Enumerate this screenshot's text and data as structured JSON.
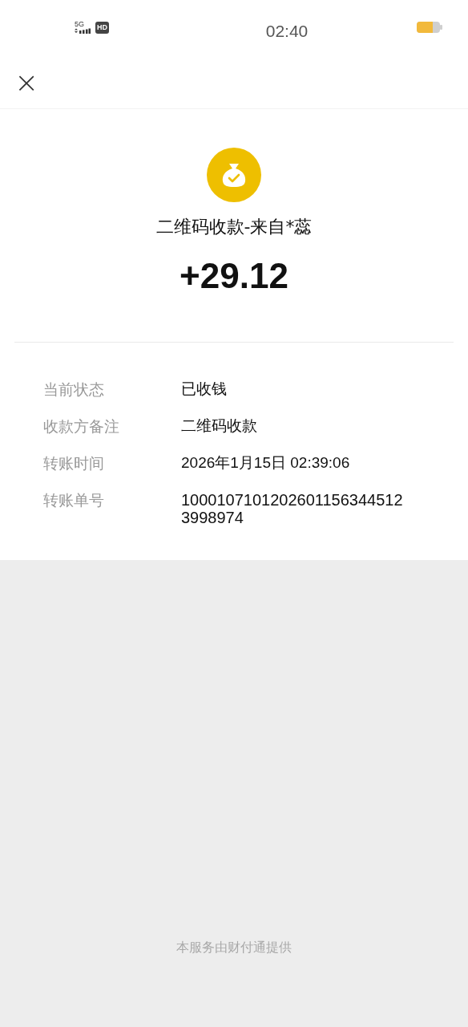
{
  "status_bar": {
    "network": "5G",
    "hd": "HD",
    "time": "02:40"
  },
  "header": {
    "close": "×"
  },
  "summary": {
    "title": "二维码收款-来自*蕊",
    "amount": "+29.12"
  },
  "details": [
    {
      "label": "当前状态",
      "value": "已收钱"
    },
    {
      "label": "收款方备注",
      "value": "二维码收款"
    },
    {
      "label": "转账时间",
      "value": "2026年1月15日 02:39:06"
    },
    {
      "label": "转账单号",
      "value": "10001071012026011563445123998974",
      "kind": "number"
    }
  ],
  "footer": "本服务由财付通提供"
}
